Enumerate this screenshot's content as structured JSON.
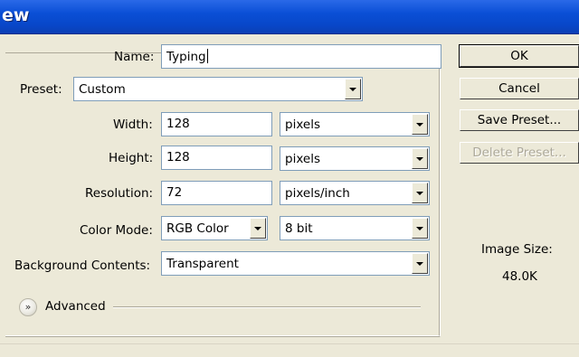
{
  "window": {
    "title": "ew"
  },
  "form": {
    "name_label": "Name:",
    "name_value": "Typing",
    "preset_label": "Preset:",
    "preset_value": "Custom",
    "width_label": "Width:",
    "width_value": "128",
    "width_unit": "pixels",
    "height_label": "Height:",
    "height_value": "128",
    "height_unit": "pixels",
    "resolution_label": "Resolution:",
    "resolution_value": "72",
    "resolution_unit": "pixels/inch",
    "color_mode_label": "Color Mode:",
    "color_mode_value": "RGB Color",
    "bit_depth_value": "8 bit",
    "background_label": "Background Contents:",
    "background_value": "Transparent",
    "advanced_label": "Advanced"
  },
  "buttons": {
    "ok": "OK",
    "cancel": "Cancel",
    "save_preset": "Save Preset...",
    "delete_preset": "Delete Preset..."
  },
  "info": {
    "image_size_label": "Image Size:",
    "image_size_value": "48.0K"
  },
  "icons": {
    "dropdown": "chevron-down-icon",
    "advanced": "double-chevron-down-icon"
  },
  "colors": {
    "titlebar": "#0a4fd6",
    "dialog_bg": "#ece9d8",
    "field_border": "#7f9db9",
    "disabled_text": "#aca899"
  }
}
